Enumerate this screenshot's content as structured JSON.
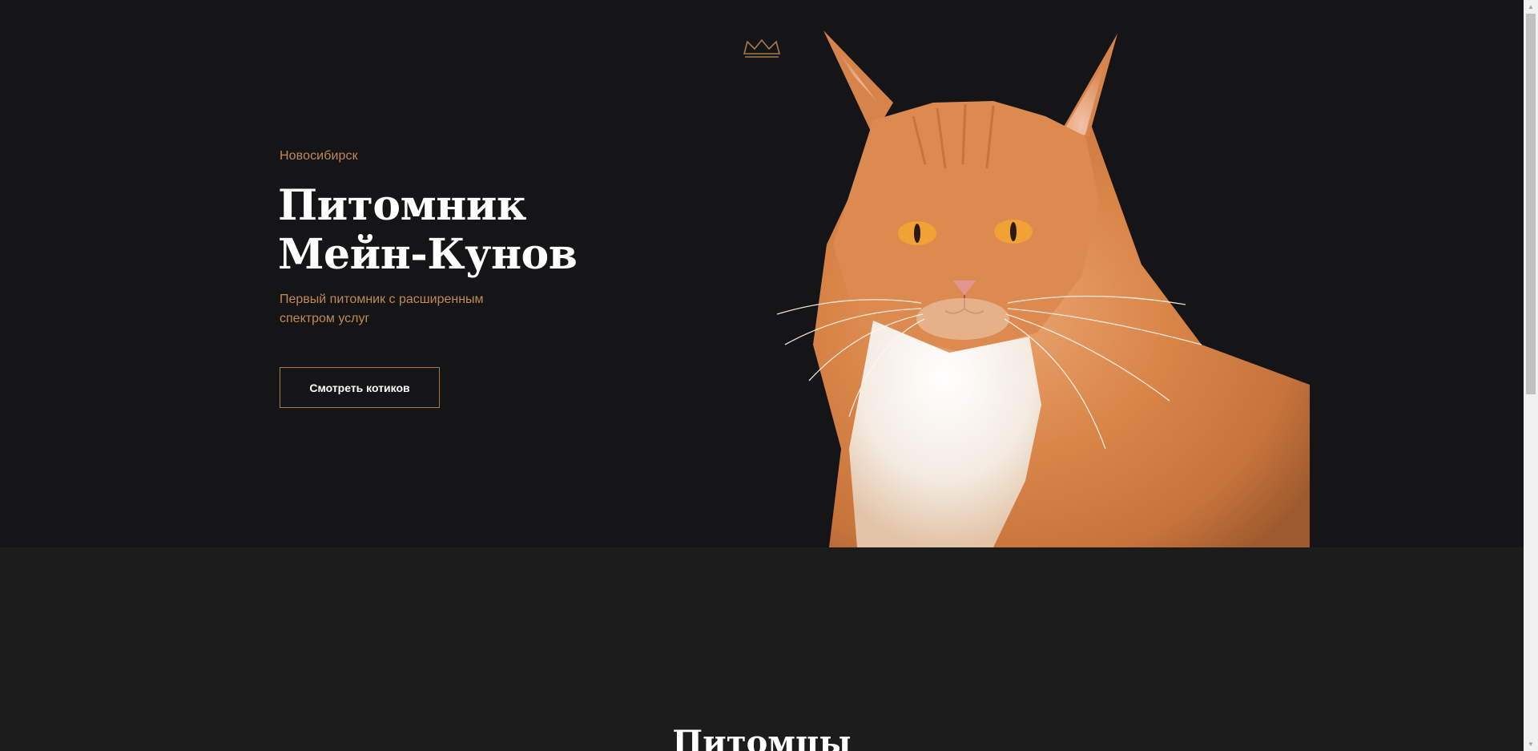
{
  "hero": {
    "city": "Новосибирск",
    "title_line1": "Питомник",
    "title_line2": "Мейн-Кунов",
    "subtitle": "Первый питомник с расширенным спектром услуг",
    "cta_label": "Смотреть котиков",
    "logo_icon": "crown-icon",
    "image_alt": "Рыжий мейн-кун"
  },
  "sections": {
    "pets_title": "Питомцы"
  },
  "colors": {
    "hero_background": "#151416",
    "section_background": "#1d1c1d",
    "accent": "#c08a55",
    "button_border": "#a77a4d",
    "text_primary": "#ffffff"
  },
  "scrollbar": {
    "up_icon": "arrow-up-icon",
    "down_icon": "arrow-down-icon"
  }
}
